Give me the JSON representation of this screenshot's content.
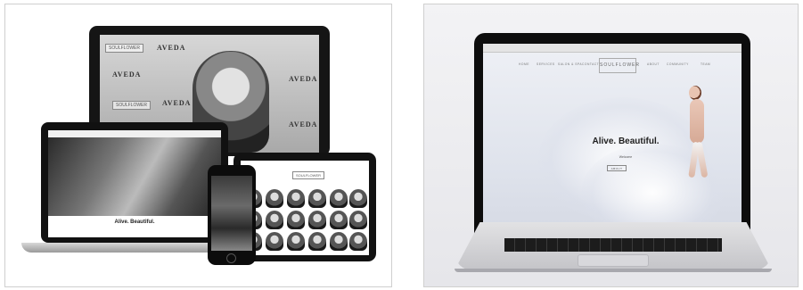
{
  "left_panel": {
    "monitor": {
      "brand_text": "AVEDA",
      "logo_text": "SOULFLOWER"
    },
    "laptop": {
      "headline": "Alive. Beautiful.",
      "logo_text": "SOULFLOWER"
    },
    "tablet": {
      "logo_text": "SOULFLOWER"
    }
  },
  "right_panel": {
    "browser_nav": [
      "HOME",
      "SERVICES",
      "SALON & SPA",
      "CONTACT",
      "ABOUT",
      "COMMUNITY",
      "TEAM"
    ],
    "logo_text": "SOULFLOWER",
    "headline": "Alive. Beautiful.",
    "subline": "Welcome",
    "button_label": "ABOUT"
  }
}
